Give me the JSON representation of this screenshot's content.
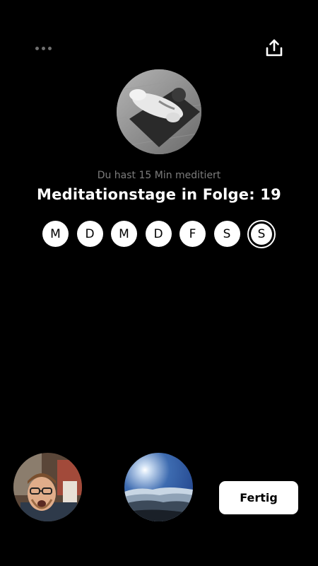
{
  "header": {
    "more_icon": "more-horizontal-icon",
    "share_icon": "share-upload-icon"
  },
  "summary": {
    "subtitle": "Du hast 15 Min meditiert",
    "title": "Meditationstage in Folge: 19"
  },
  "week": {
    "days": [
      "M",
      "D",
      "M",
      "D",
      "F",
      "S",
      "S"
    ],
    "current_index": 6
  },
  "footer": {
    "done_label": "Fertig"
  },
  "colors": {
    "background": "#000000",
    "text_primary": "#ffffff",
    "text_secondary": "#7c7c7c",
    "button_bg": "#ffffff"
  }
}
